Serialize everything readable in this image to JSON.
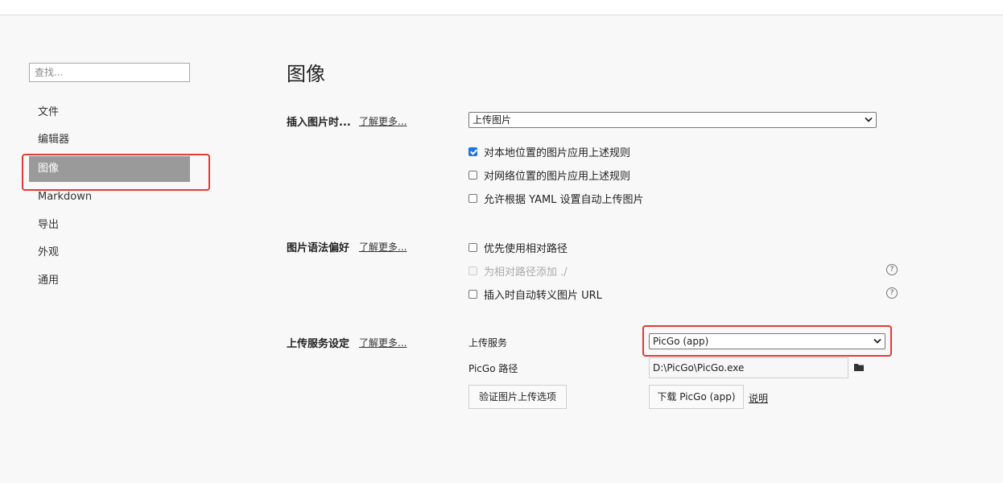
{
  "sidebar": {
    "search_placeholder": "查找...",
    "items": [
      "文件",
      "编辑器",
      "图像",
      "Markdown",
      "导出",
      "外观",
      "通用"
    ],
    "active_index": 2
  },
  "main": {
    "title": "图像",
    "learn_more": "了解更多...",
    "insert": {
      "label": "插入图片时...",
      "select_value": "上传图片",
      "options": [
        {
          "label": "对本地位置的图片应用上述规则",
          "checked": true
        },
        {
          "label": "对网络位置的图片应用上述规则",
          "checked": false
        },
        {
          "label": "允许根据 YAML 设置自动上传图片",
          "checked": false
        }
      ]
    },
    "syntax": {
      "label": "图片语法偏好",
      "options": [
        {
          "label": "优先使用相对路径",
          "checked": false,
          "disabled": false
        },
        {
          "label": "为相对路径添加 ./",
          "checked": false,
          "disabled": true
        },
        {
          "label": "插入时自动转义图片 URL",
          "checked": false,
          "disabled": false
        }
      ],
      "help": "?"
    },
    "upload": {
      "label": "上传服务设定",
      "service_label": "上传服务",
      "service_value": "PicGo (app)",
      "path_label": "PicGo 路径",
      "path_value": "D:\\PicGo\\PicGo.exe",
      "validate_button": "验证图片上传选项",
      "download_button": "下载 PicGo (app)",
      "explain_link": "说明"
    }
  },
  "colors": {
    "accent": "#1a73e8",
    "annotation": "#e53935",
    "active_nav": "#9a9a9a"
  }
}
